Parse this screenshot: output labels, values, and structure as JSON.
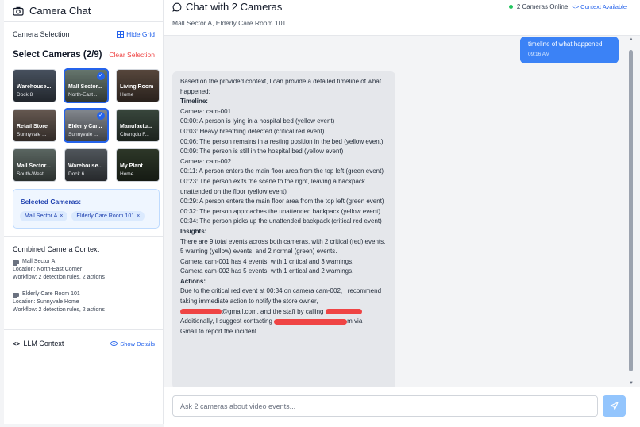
{
  "sidebar": {
    "title": "Camera Chat",
    "selection_label": "Camera Selection",
    "hide_grid": "Hide Grid",
    "select_title": "Select Cameras (2/9)",
    "clear_selection": "Clear Selection",
    "cameras": [
      {
        "name": "Warehouse...",
        "location": "Dock 8",
        "selected": false,
        "bg": "#4b5563"
      },
      {
        "name": "Mall Sector...",
        "location": "North-East ...",
        "selected": true,
        "bg": "#6b7c73"
      },
      {
        "name": "Living Room",
        "location": "Home",
        "selected": false,
        "bg": "#5b4a3f"
      },
      {
        "name": "Retail Store",
        "location": "Sunnyvale ...",
        "selected": false,
        "bg": "#6b5d55"
      },
      {
        "name": "Elderly Car...",
        "location": "Sunnyvale ...",
        "selected": true,
        "bg": "#8a8f96"
      },
      {
        "name": "Manufactu...",
        "location": "Chengdu F...",
        "selected": false,
        "bg": "#3b4a3f"
      },
      {
        "name": "Mall Sector...",
        "location": "South-West...",
        "selected": false,
        "bg": "#5f6b66"
      },
      {
        "name": "Warehouse...",
        "location": "Dock 6",
        "selected": false,
        "bg": "#545a60"
      },
      {
        "name": "My Plant",
        "location": "Home",
        "selected": false,
        "bg": "#2f3a2a"
      }
    ],
    "selected_title": "Selected Cameras:",
    "selected_chips": [
      "Mall Sector A",
      "Elderly Care Room 101"
    ],
    "context_title": "Combined Camera Context",
    "contexts": [
      {
        "name": "Mall Sector A",
        "location": "Location: North-East Corner",
        "workflow": "Workflow: 2 detection rules, 2 actions"
      },
      {
        "name": "Elderly Care Room 101",
        "location": "Location: Sunnyvale Home",
        "workflow": "Workflow: 2 detection rules, 2 actions"
      }
    ],
    "llm_title": "LLM Context",
    "show_details": "Show Details"
  },
  "header": {
    "title": "Chat with 2 Cameras",
    "subtitle": "Mall Sector A, Elderly Care Room 101",
    "online": "2 Cameras Online",
    "context": "Context Available"
  },
  "messages": {
    "user": {
      "text": "timeline of what happened",
      "time": "09:16 AM"
    },
    "bot": {
      "intro": "Based on the provided context, I can provide a detailed timeline of what happened:",
      "timeline_head": "Timeline:",
      "cam1": "Camera: cam-001",
      "e1": "00:00: A person is lying in a hospital bed (yellow event)",
      "e2": "00:03: Heavy breathing detected (critical red event)",
      "e3": "00:06: The person remains in a resting position in the bed (yellow event)",
      "e4": "00:09: The person is still in the hospital bed (yellow event)",
      "cam2": "Camera: cam-002",
      "e5": "00:11: A person enters the main floor area from the top left (green event)",
      "e6": "00:23: The person exits the scene to the right, leaving a backpack unattended on the floor (yellow event)",
      "e7": "00:29: A person enters the main floor area from the top left (green event)",
      "e8": "00:32: The person approaches the unattended backpack (yellow event)",
      "e9": "00:34: The person picks up the unattended backpack (critical red event)",
      "insights_head": "Insights:",
      "i1": "There are 9 total events across both cameras, with 2 critical (red) events, 5 warning (yellow) events, and 2 normal (green) events.",
      "i2": "Camera cam-001 has 4 events, with 1 critical and 3 warnings.",
      "i3": "Camera cam-002 has 5 events, with 1 critical and 2 warnings.",
      "actions_head": "Actions:",
      "a1": "Due to the critical red event at 00:34 on camera cam-002, I recommend taking immediate action to notify the store owner,",
      "a2_tail": "@gmail.com, and the staff by calling",
      "a3_head": "Additionally, I suggest contacting",
      "a3_tail": "m via",
      "a4": "Gmail to report the incident."
    }
  },
  "input": {
    "placeholder": "Ask 2 cameras about video events..."
  }
}
